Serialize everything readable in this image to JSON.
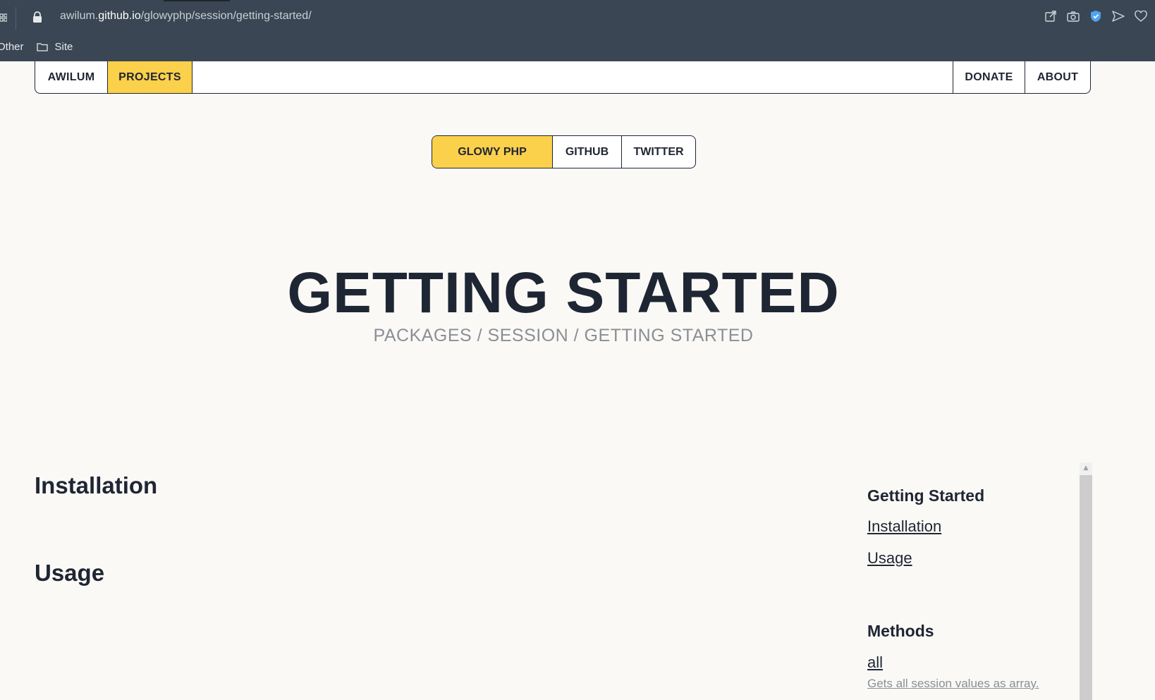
{
  "browser": {
    "url_prefix": "awilum.",
    "url_host": "github.io",
    "url_path": "/glowyphp/session/getting-started/",
    "bookmarks": [
      "Other",
      "Site"
    ]
  },
  "topnav": {
    "brand": "AWILUM",
    "projects": "PROJECTS",
    "donate": "DONATE",
    "about": "ABOUT"
  },
  "subnav": {
    "glowy": "GLOWY PHP",
    "github": "GITHUB",
    "twitter": "TWITTER"
  },
  "hero": {
    "title": "GETTING STARTED",
    "breadcrumb": "PACKAGES / SESSION / GETTING STARTED"
  },
  "main": {
    "sections": [
      "Installation",
      "Usage"
    ]
  },
  "sidebar": {
    "group1_title": "Getting Started",
    "group1_links": [
      "Installation",
      "Usage"
    ],
    "group2_title": "Methods",
    "method_all": "all",
    "method_all_desc": "Gets all session values as array."
  },
  "colors": {
    "accent": "#fbd04a",
    "text": "#1f2633",
    "background": "#faf9f6",
    "chrome": "#3a4653"
  }
}
